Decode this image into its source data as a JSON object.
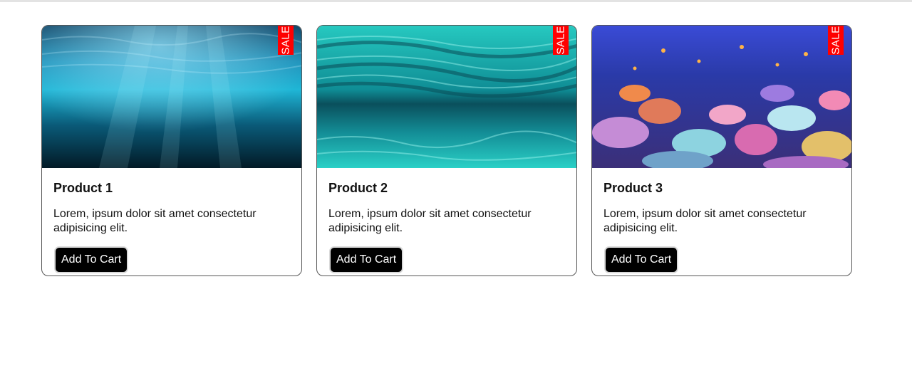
{
  "products": [
    {
      "name": "Product 1",
      "description": "Lorem, ipsum dolor sit amet consectetur adipisicing elit.",
      "button_label": "Add To Cart",
      "badge": "SALE",
      "image": "underwater-deep-blue-photo"
    },
    {
      "name": "Product 2",
      "description": "Lorem, ipsum dolor sit amet consectetur adipisicing elit.",
      "button_label": "Add To Cart",
      "badge": "SALE",
      "image": "underwater-turquoise-photo"
    },
    {
      "name": "Product 3",
      "description": "Lorem, ipsum dolor sit amet consectetur adipisicing elit.",
      "button_label": "Add To Cart",
      "badge": "SALE",
      "image": "coral-reef-photo"
    }
  ],
  "colors": {
    "badge_bg": "#ff0000",
    "button_bg": "#000000",
    "card_border": "#555555"
  }
}
